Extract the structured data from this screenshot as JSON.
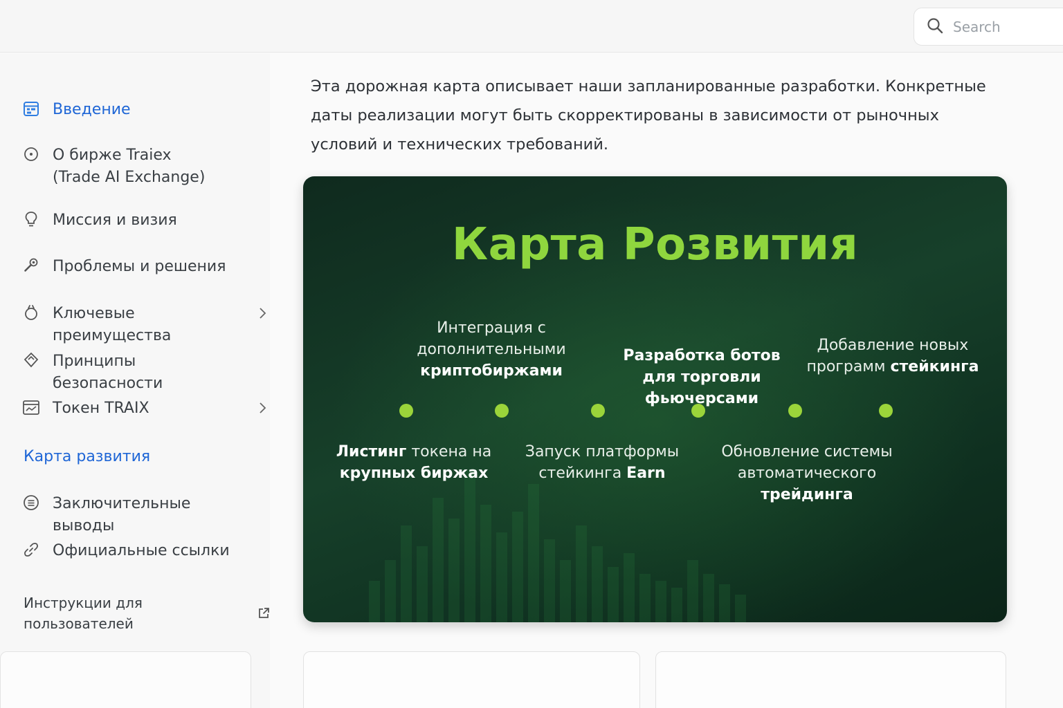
{
  "search": {
    "placeholder": "Search"
  },
  "sidebar": {
    "items": [
      {
        "label": "Введение",
        "icon": "calendar-grid-icon",
        "active": true
      },
      {
        "label": "О бирже Traiex\n(Trade AI Exchange)",
        "icon": "info-circle-icon"
      },
      {
        "label": "Миссия и визия",
        "icon": "lightbulb-icon"
      },
      {
        "label": "Проблемы и решения",
        "icon": "wrench-icon"
      },
      {
        "label": "Ключевые преимущества",
        "icon": "award-icon",
        "expandable": true
      },
      {
        "label": "Принципы безопасности",
        "icon": "diamond-shield-icon"
      },
      {
        "label": "Токен TRAIX",
        "icon": "token-calendar-icon",
        "expandable": true
      }
    ],
    "section": "Карта развития",
    "items_after": [
      {
        "label": "Заключительные выводы",
        "icon": "list-circle-icon"
      },
      {
        "label": "Официальные ссылки",
        "icon": "link-icon"
      }
    ],
    "external_link": "Инструкции для пользователей"
  },
  "main": {
    "intro": "Эта дорожная карта описывает наши запланированные разработки. Конкретные даты реализации могут быть скорректированы в зависимости от рыночных условий и технических требований.",
    "roadmap": {
      "title": "Карта Розвития",
      "milestones_top": [
        {
          "normal_before": "Интеграция с\nдополнительными\n",
          "bold": "криптобиржами",
          "normal_after": ""
        },
        {
          "normal_before": "",
          "bold": "Разработка ботов\nдля торговли\nфьючерсами",
          "normal_after": ""
        },
        {
          "normal_before": "Добавление новых\nпрограмм ",
          "bold": "стейкинга",
          "normal_after": ""
        }
      ],
      "milestones_bottom": [
        {
          "normal_before": "",
          "bold": "Листинг",
          "normal_after": " токена на\n",
          "bold2": "крупных биржах"
        },
        {
          "normal_before": "Запуск платформы\nстейкинга ",
          "bold": "Earn",
          "normal_after": ""
        },
        {
          "normal_before": "Обновление системы\nавтоматического\n",
          "bold": "трейдинга",
          "normal_after": ""
        }
      ]
    }
  },
  "colors": {
    "accent_blue": "#1f66d6",
    "roadmap_green": "#8fd63e",
    "roadmap_bg": "#143a26",
    "dot_green": "#9bd43a"
  }
}
